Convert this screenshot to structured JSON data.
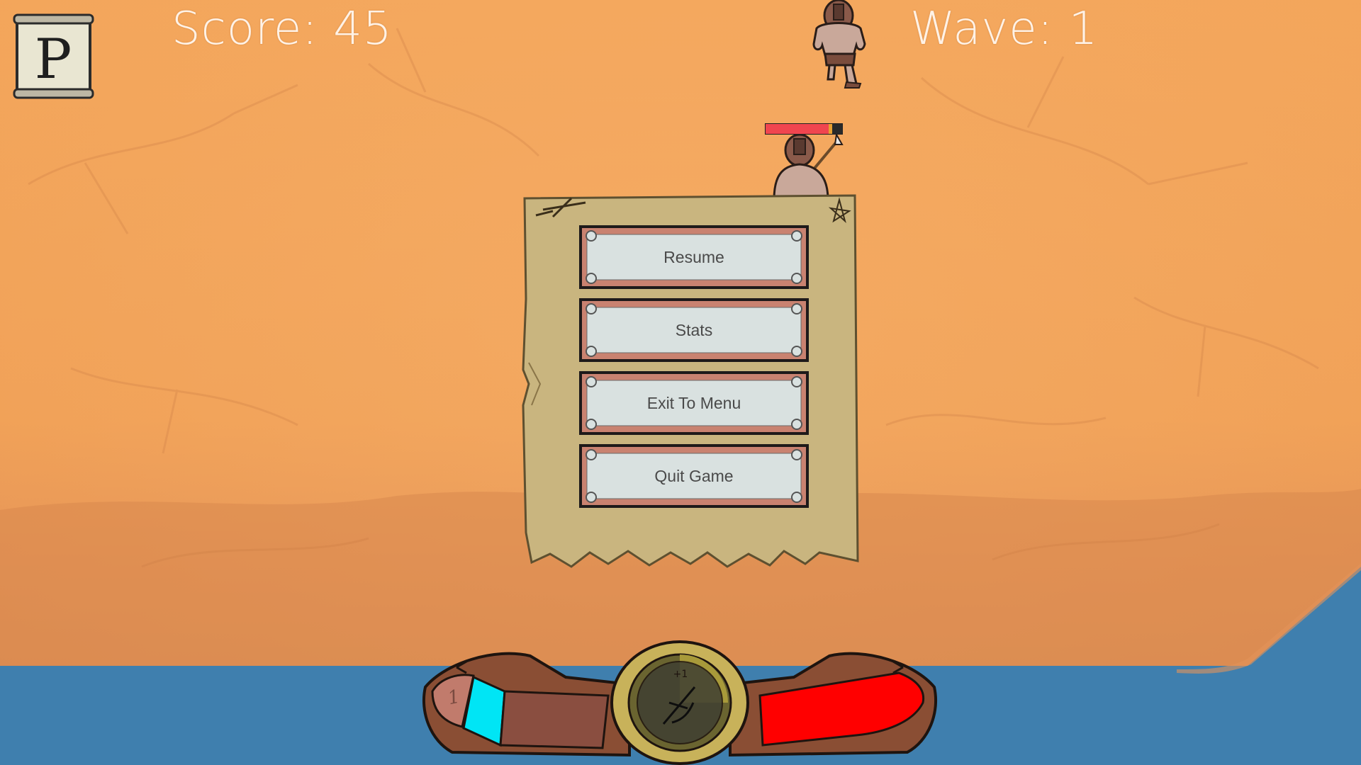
{
  "hud": {
    "score_label": "Score: 45",
    "wave_label": "Wave: 1",
    "pause_glyph": "P"
  },
  "pause_menu": {
    "buttons": [
      {
        "label": "Resume"
      },
      {
        "label": "Stats"
      },
      {
        "label": "Exit To Menu"
      },
      {
        "label": "Quit Game"
      }
    ]
  },
  "enemies": [
    {
      "name": "brute-walking",
      "health_fraction": null
    },
    {
      "name": "spearman",
      "health_fraction": 0.82
    }
  ],
  "hotbar": {
    "slot_number": "1",
    "center_badge": "+1",
    "mana_color": "#00e5f5",
    "health_color": "#ff0000",
    "health_fraction": 1.0
  },
  "colors": {
    "sky": "#f0a35a",
    "water": "#3f7fae",
    "parchment": "#c9b57f",
    "button_face": "#d9e1e0",
    "button_border": "#c98270"
  }
}
